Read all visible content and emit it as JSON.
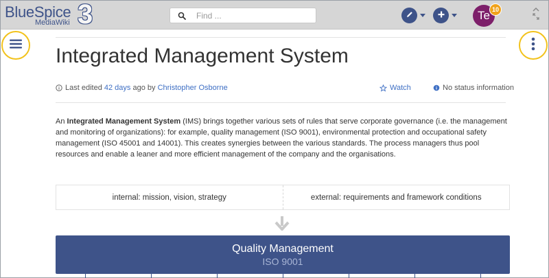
{
  "header": {
    "logo_main": "BlueSpice",
    "logo_sub": "MediaWiki",
    "logo_number": "3",
    "search_placeholder": "Find ...",
    "avatar_initials": "Te",
    "notification_count": "10"
  },
  "page": {
    "title": "Integrated Management System",
    "meta": {
      "last_edited_prefix": "Last edited",
      "last_edited_link": "42 days",
      "ago_by": "ago by",
      "author": "Christopher Osborne",
      "watch_label": "Watch",
      "status_label": "No status information"
    },
    "intro": {
      "lead": "An ",
      "bold_term": "Integrated Management System",
      "body": " (IMS) brings together various sets of rules that serve corporate governance (i.e. the management and monitoring of organizations): for example, quality management (ISO 9001), environmental protection and occupational safety management (ISO 45001 and 14001). This creates synergies between the various standards. The process managers thus pool resources and enable a leaner and more efficient management of the company and the organisations."
    }
  },
  "diagram": {
    "left_cell": "internal: mission, vision, strategy",
    "right_cell": "external: requirements and framework conditions",
    "box_title": "Quality Management",
    "box_subtitle": "ISO 9001"
  },
  "colors": {
    "brand": "#3e5389",
    "highlight_ring": "#f2c21b",
    "avatar_bg": "#7d1f6a",
    "badge_bg": "#f0a21a",
    "link": "#3e6fc4"
  }
}
